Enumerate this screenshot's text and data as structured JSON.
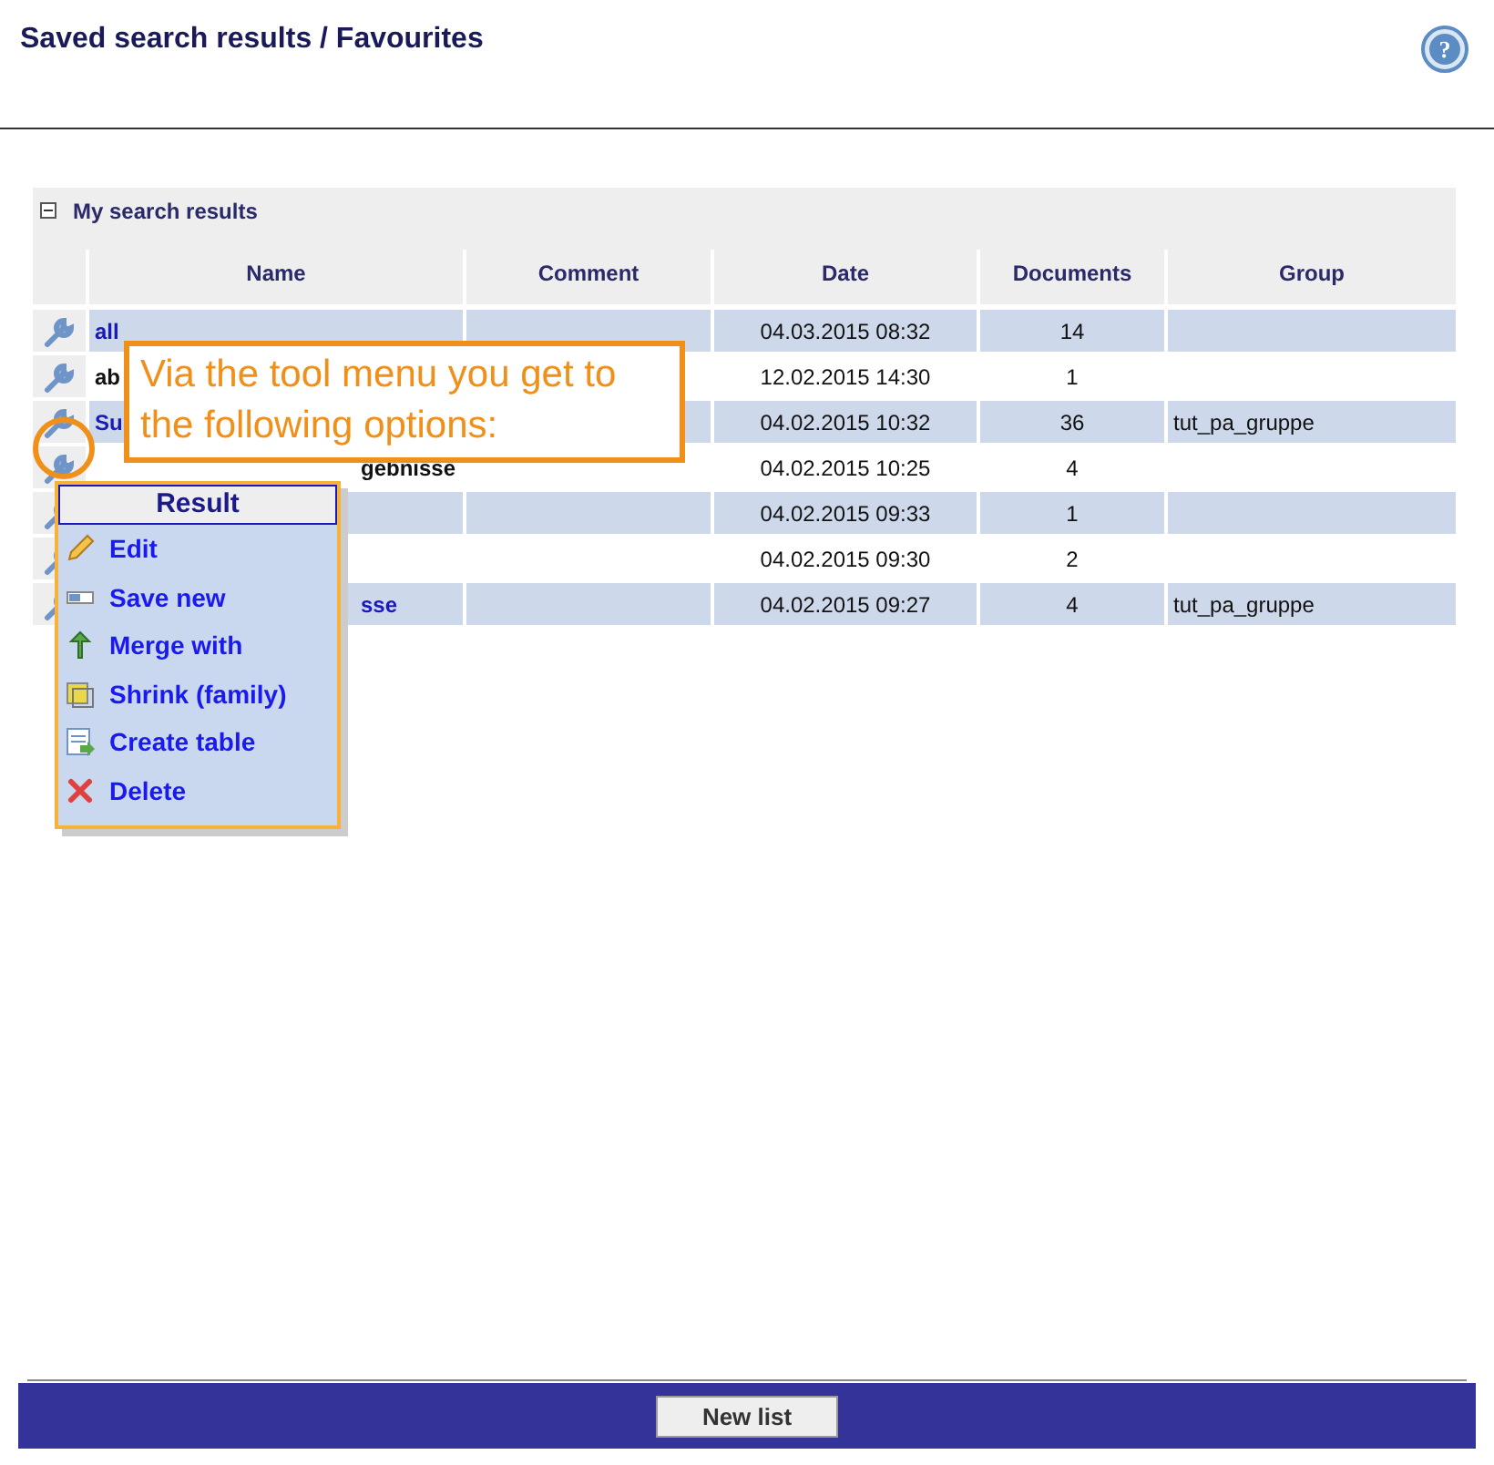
{
  "page": {
    "title": "Saved search results / Favourites",
    "help": "?"
  },
  "section": {
    "title": "My search results",
    "expanded": true
  },
  "table": {
    "columns": [
      "Name",
      "Comment",
      "Date",
      "Documents",
      "Group"
    ],
    "rows": [
      {
        "name": "all",
        "date": "04.03.2015 08:32",
        "documents": "14",
        "group": "",
        "highlighted": true,
        "under_menu": false
      },
      {
        "name": "ab",
        "date": "12.02.2015 14:30",
        "documents": "1",
        "group": "",
        "highlighted": false,
        "under_menu": false
      },
      {
        "name": "Su",
        "date": "04.02.2015 10:32",
        "documents": "36",
        "group": "tut_pa_gruppe",
        "highlighted": true,
        "under_menu": false
      },
      {
        "name": "gebnisse",
        "date": "04.02.2015 10:25",
        "documents": "4",
        "group": "",
        "highlighted": false,
        "under_menu": true
      },
      {
        "name": "",
        "date": "04.02.2015 09:33",
        "documents": "1",
        "group": "",
        "highlighted": true
      },
      {
        "name": "",
        "date": "04.02.2015 09:30",
        "documents": "2",
        "group": "",
        "highlighted": false
      },
      {
        "name": "sse",
        "date": "04.02.2015 09:27",
        "documents": "4",
        "group": "tut_pa_gruppe",
        "highlighted": true,
        "under_menu": true
      }
    ]
  },
  "callout": {
    "text": "Via the tool menu you get to the following options:"
  },
  "menu": {
    "title": "Result",
    "items": [
      {
        "label": "Edit",
        "kind": "edit"
      },
      {
        "label": "Save new",
        "kind": "save"
      },
      {
        "label": "Merge with",
        "kind": "merge"
      },
      {
        "label": "Shrink (family)",
        "kind": "shrink"
      },
      {
        "label": "Create table",
        "kind": "table"
      },
      {
        "label": "Delete",
        "kind": "delete"
      }
    ]
  },
  "footer": {
    "button": "New list"
  }
}
